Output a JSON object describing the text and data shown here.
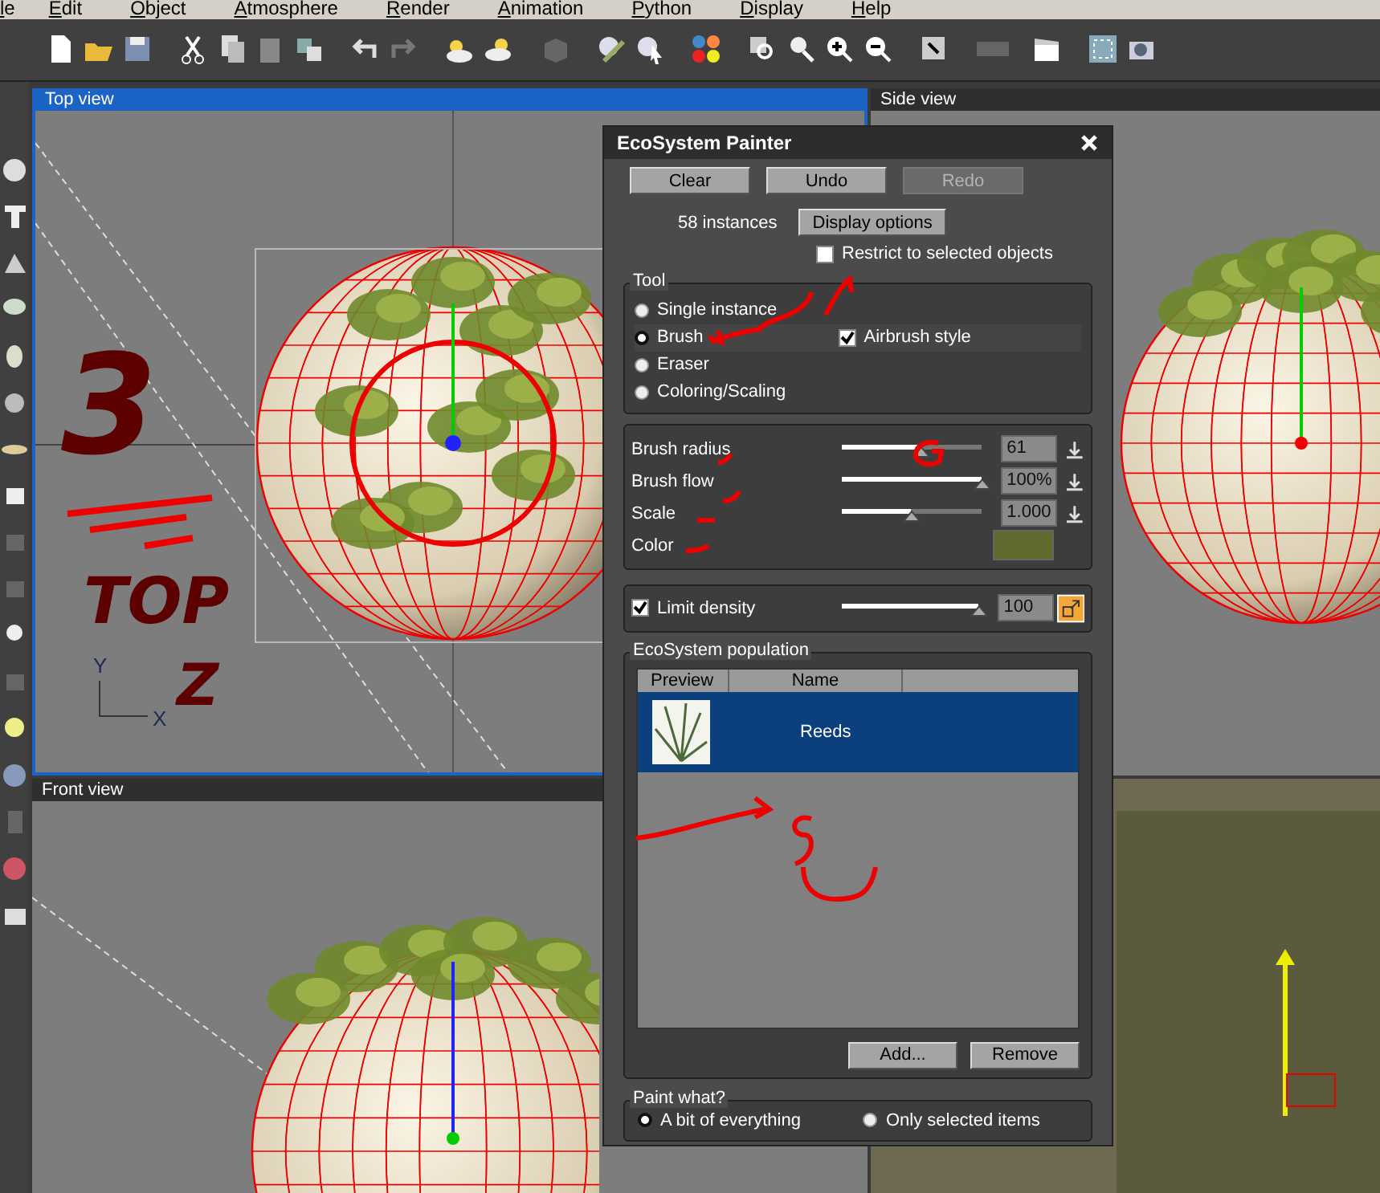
{
  "menu_bar": {
    "items": [
      "le",
      "Edit",
      "Object",
      "Atmosphere",
      "Render",
      "Animation",
      "Python",
      "Display",
      "Help"
    ]
  },
  "viewports": [
    {
      "title": "Top view",
      "selected": true
    },
    {
      "title": "Side view",
      "selected": false
    },
    {
      "title": "Front view",
      "selected": false
    }
  ],
  "dialog": {
    "title": "EcoSystem Painter",
    "buttons": [
      {
        "label": "Clear",
        "disabled": false
      },
      {
        "label": "Undo",
        "disabled": false
      },
      {
        "label": "Redo",
        "disabled": true
      }
    ],
    "instances": "58 instances",
    "display_options": "Display options",
    "restrict": {
      "label": "Restrict to selected objects",
      "checked": false
    },
    "tool": {
      "title": "Tool",
      "options": [
        {
          "label": "Single instance",
          "selected": false
        },
        {
          "label": "Brush",
          "selected": true
        },
        {
          "label": "Eraser",
          "selected": false
        },
        {
          "label": "Coloring/Scaling",
          "selected": false
        }
      ],
      "airbrush": {
        "label": "Airbrush style",
        "checked": true
      }
    },
    "params": [
      {
        "kind": "slider",
        "label": "Brush radius",
        "level": 0.57,
        "value": "61"
      },
      {
        "kind": "slider",
        "label": "Brush flow",
        "level": 1,
        "value": "100%"
      },
      {
        "kind": "slider",
        "label": "Scale",
        "level": 0.5,
        "value": "1.000"
      },
      {
        "kind": "color",
        "label": "Color",
        "color": "#5f6a2e"
      }
    ],
    "density": {
      "label": "Limit density",
      "checked": true,
      "level": 1,
      "value": "100"
    },
    "population": {
      "title": "EcoSystem population",
      "columns": [
        "Preview",
        "Name"
      ],
      "rows": [
        {
          "name": "Reeds",
          "selected": true
        }
      ],
      "buttons": [
        "Add...",
        "Remove"
      ]
    },
    "paint_what": {
      "title": "Paint what?",
      "options": [
        {
          "label": "A bit of everything",
          "selected": true
        },
        {
          "label": "Only selected items",
          "selected": false
        }
      ]
    }
  },
  "axis_labels": [
    "Y",
    "X"
  ],
  "annotations": [
    {
      "text": "3"
    },
    {
      "text": "TOP"
    },
    {
      "text": "Z"
    }
  ]
}
